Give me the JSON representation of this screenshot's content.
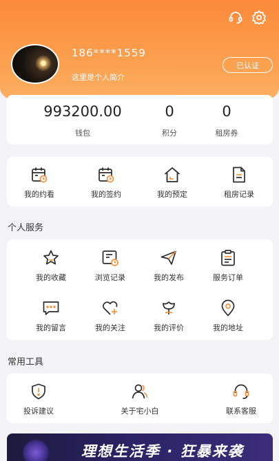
{
  "profile": {
    "phone": "186****1559",
    "intro": "这里是个人简介",
    "verified_label": "已认证"
  },
  "stats": [
    {
      "value": "993200.00",
      "label": "钱包"
    },
    {
      "value": "0",
      "label": "积分"
    },
    {
      "value": "0",
      "label": "租房券"
    }
  ],
  "quick_actions": [
    {
      "label": "我的约看",
      "icon": "calendar-clock-icon"
    },
    {
      "label": "我的签约",
      "icon": "calendar-clock-icon"
    },
    {
      "label": "我的预定",
      "icon": "house-icon"
    },
    {
      "label": "租房记录",
      "icon": "document-icon"
    }
  ],
  "personal_services": {
    "title": "个人服务",
    "items": [
      {
        "label": "我的收藏",
        "icon": "star-icon"
      },
      {
        "label": "浏览记录",
        "icon": "history-icon"
      },
      {
        "label": "我的发布",
        "icon": "send-icon"
      },
      {
        "label": "服务订单",
        "icon": "clipboard-icon"
      },
      {
        "label": "我的留言",
        "icon": "message-icon"
      },
      {
        "label": "我的关注",
        "icon": "heart-plus-icon"
      },
      {
        "label": "我的评价",
        "icon": "flower-icon"
      },
      {
        "label": "我的地址",
        "icon": "location-pin-icon"
      }
    ]
  },
  "tools": {
    "title": "常用工具",
    "items": [
      {
        "label": "投诉建议",
        "icon": "shield-alert-icon"
      },
      {
        "label": "关于宅小白",
        "icon": "people-icon"
      },
      {
        "label": "联系客服",
        "icon": "headset-icon"
      }
    ]
  },
  "banner": {
    "text": "理想生活季 · 狂暴来袭"
  },
  "colors": {
    "accent": "#f7913c",
    "icon_dark": "#2b2b2b"
  }
}
